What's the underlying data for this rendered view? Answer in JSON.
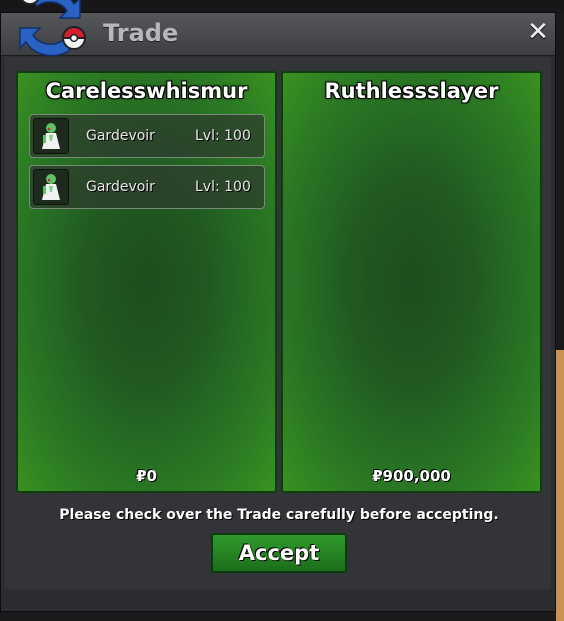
{
  "window": {
    "title": "Trade",
    "close_icon": "close-icon"
  },
  "left_panel": {
    "player_name": "Carelesswhismur",
    "items": [
      {
        "name": "Gardevoir",
        "level": "Lvl: 100",
        "icon": "gardevoir-sprite-icon"
      },
      {
        "name": "Gardevoir",
        "level": "Lvl: 100",
        "icon": "gardevoir-sprite-icon"
      }
    ],
    "money": "₽0"
  },
  "right_panel": {
    "player_name": "Ruthlessslayer",
    "items": [],
    "money": "₽900,000"
  },
  "footer": {
    "message": "Please check over the Trade carefully before accepting.",
    "accept_label": "Accept"
  },
  "colors": {
    "panel_green": "#2b7a24",
    "accept_green": "#2f9a2c",
    "title_gray": "#b5b7bc"
  }
}
